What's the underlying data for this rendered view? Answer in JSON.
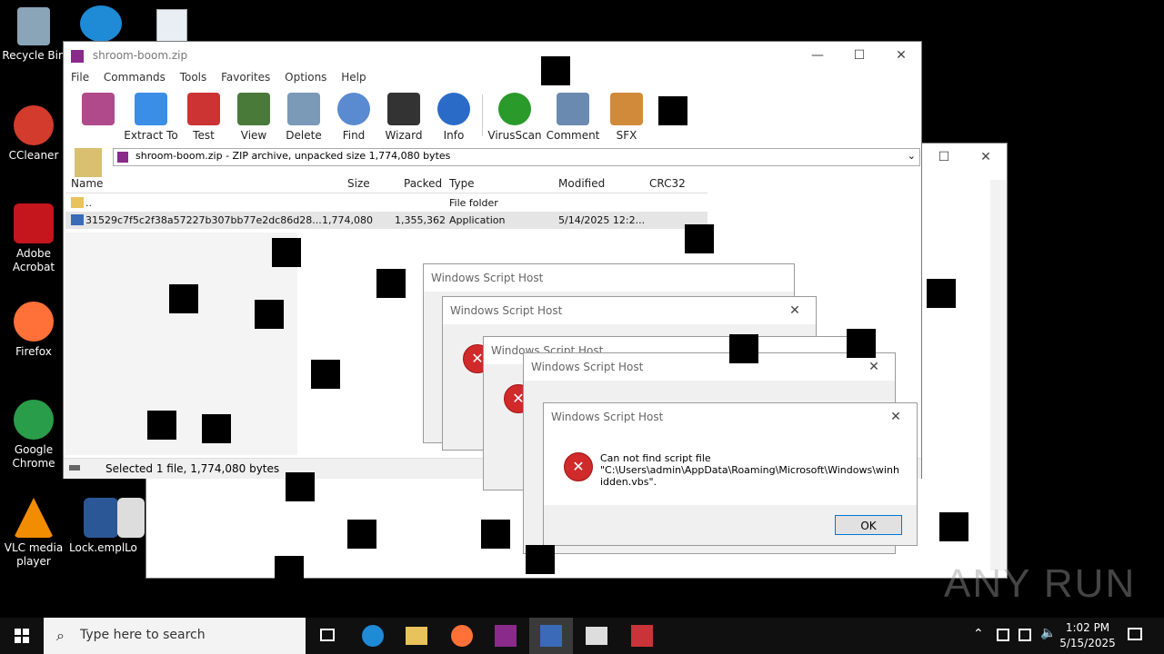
{
  "desktop": {
    "icons": [
      {
        "label": "Recycle Bin",
        "icon": "recycle-bin-icon",
        "color": "#8aa4b8"
      },
      {
        "label": "CCleaner",
        "icon": "ccleaner-icon",
        "color": "#d33b2c"
      },
      {
        "label": "Adobe Acrobat",
        "icon": "acrobat-icon",
        "color": "#c4161c"
      },
      {
        "label": "Firefox",
        "icon": "firefox-icon",
        "color": "#ff7139"
      },
      {
        "label": "Google Chrome",
        "icon": "chrome-icon",
        "color": "#2a9d4a"
      },
      {
        "label": "VLC media player",
        "icon": "vlc-icon",
        "color": "#f28c00"
      },
      {
        "label": "Lock.empl...",
        "icon": "word-doc-icon",
        "color": "#2b5797"
      },
      {
        "label": "Lo",
        "icon": "file-icon",
        "color": "#dddddd"
      }
    ]
  },
  "winrar": {
    "title": "shroom-boom.zip",
    "menu": [
      "File",
      "Commands",
      "Tools",
      "Favorites",
      "Options",
      "Help"
    ],
    "toolbar": [
      {
        "label": "Extract To",
        "icon": "extract-folder-icon",
        "color": "#3a8ee6"
      },
      {
        "label": "Test",
        "icon": "test-clipboard-icon",
        "color": "#c33"
      },
      {
        "label": "View",
        "icon": "view-book-icon",
        "color": "#4a7a3a"
      },
      {
        "label": "Delete",
        "icon": "delete-bin-icon",
        "color": "#7a9ab8"
      },
      {
        "label": "Find",
        "icon": "find-magnifier-icon",
        "color": "#5a8ad0"
      },
      {
        "label": "Wizard",
        "icon": "wizard-wand-icon",
        "color": "#333"
      },
      {
        "label": "Info",
        "icon": "info-icon",
        "color": "#2a6bc8"
      },
      {
        "label": "VirusScan",
        "icon": "virusscan-icon",
        "color": "#2a9a2a"
      },
      {
        "label": "Comment",
        "icon": "comment-icon",
        "color": "#6a8ab0"
      },
      {
        "label": "SFX",
        "icon": "sfx-box-icon",
        "color": "#d08a3a"
      }
    ],
    "path": "shroom-boom.zip - ZIP archive, unpacked size 1,774,080 bytes",
    "columns": [
      "Name",
      "Size",
      "Packed",
      "Type",
      "Modified",
      "CRC32"
    ],
    "rows": [
      {
        "name": "..",
        "size": "",
        "packed": "",
        "type": "File folder",
        "modified": "",
        "crc": ""
      },
      {
        "name": "31529c7f5c2f38a57227b307bb77e2dc86d28...",
        "size": "1,774,080",
        "packed": "1,355,362",
        "type": "Application",
        "modified": "5/14/2025 12:2...",
        "crc": ""
      }
    ],
    "status": "Selected 1 file, 1,774,080 bytes"
  },
  "dialogs": {
    "title": "Windows Script Host",
    "message_line1": "Can not find script file",
    "message_line2": "\"C:\\Users\\admin\\AppData\\Roaming\\Microsoft\\Windows\\winh",
    "message_line3": "idden.vbs\".",
    "ok_label": "OK",
    "error_glyph": "✕"
  },
  "taskbar": {
    "search_placeholder": "Type here to search",
    "time": "1:02 PM",
    "date": "5/15/2025"
  },
  "watermark": "ANY RUN"
}
